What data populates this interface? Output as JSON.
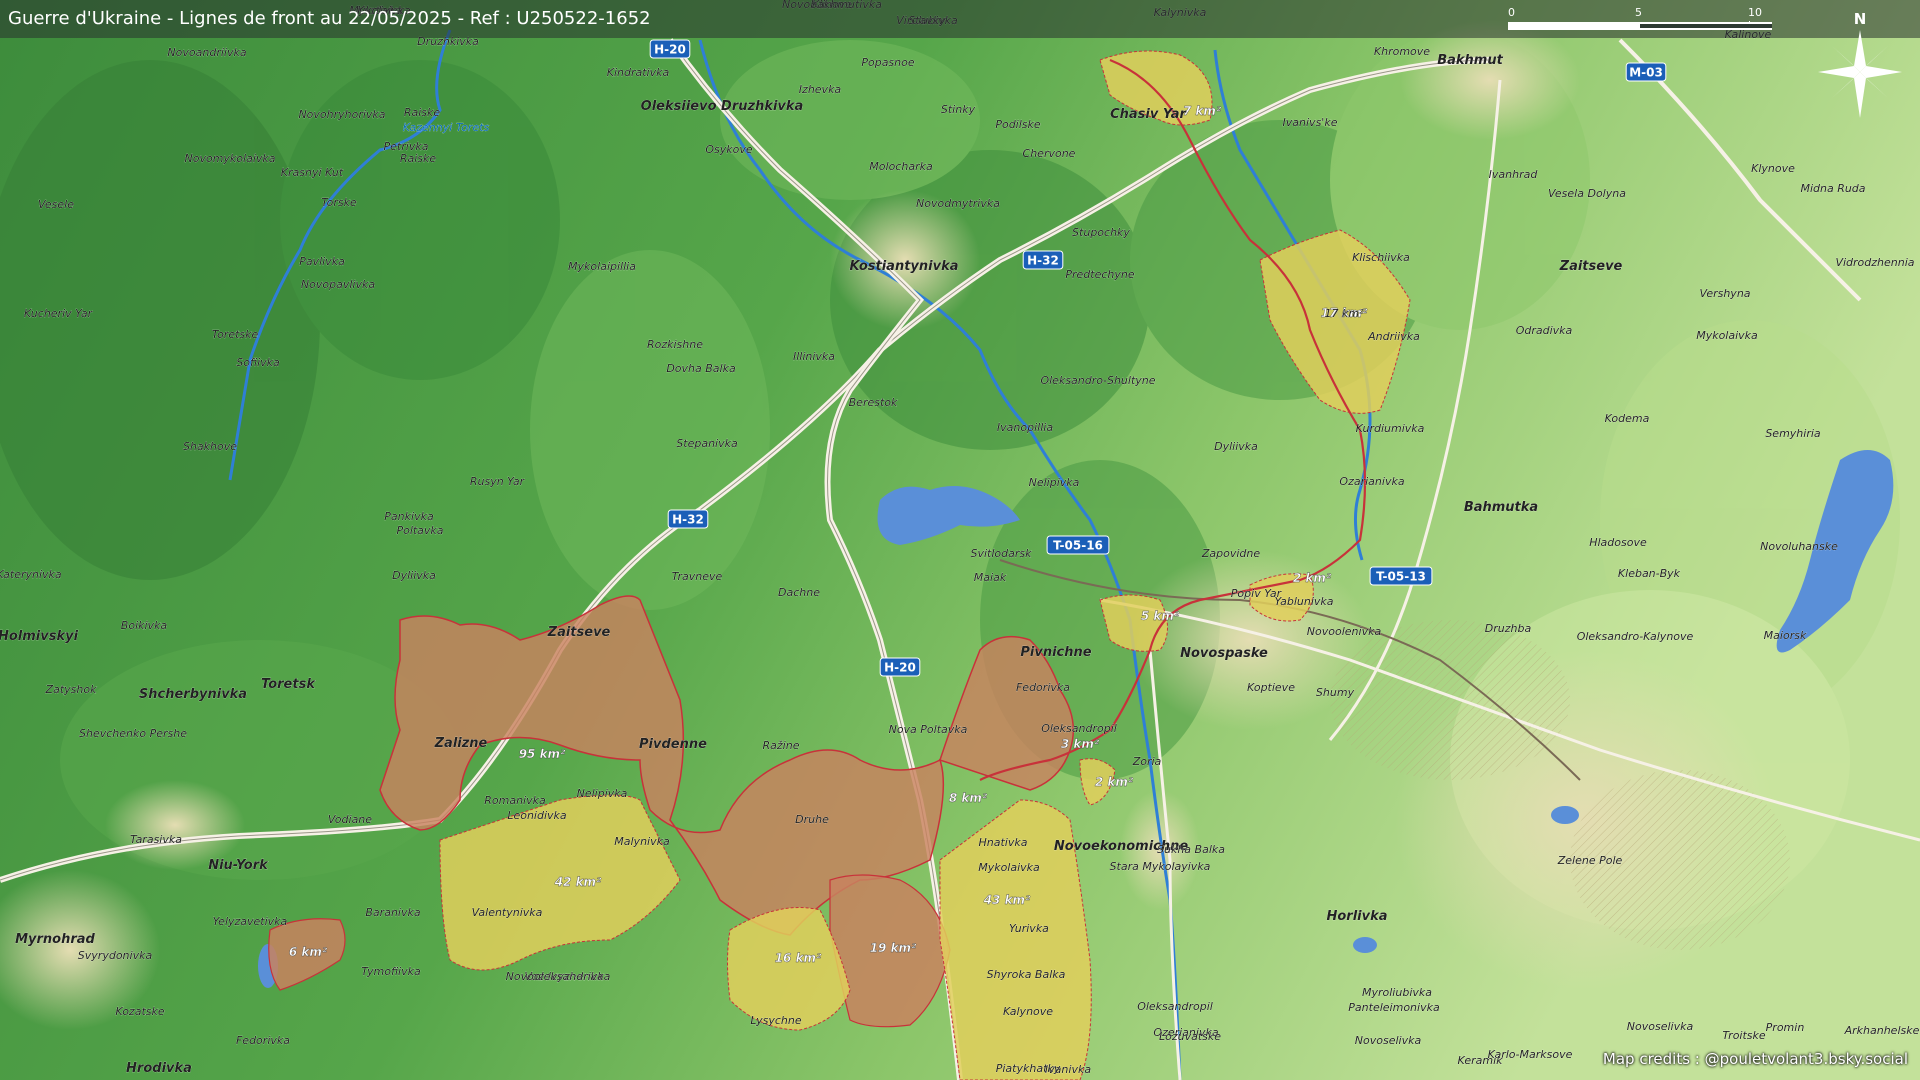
{
  "title": "Guerre d'Ukraine - Lignes de front au 22/05/2025 - Ref : U250522-1652",
  "credits": "Map credits : @pouletvolant3.bsky.social",
  "scale": {
    "ticks": [
      "0",
      "5",
      "10 km"
    ]
  },
  "north_label": "N",
  "colors": {
    "terrain_dark": "#3f8f3d",
    "terrain_light": "#cfe89a",
    "occupied": "#c8825f",
    "contested": "#e0cf5c",
    "frontline": "#c8323a",
    "river": "#2f7fd6",
    "road_badge": "#1b5fb8"
  },
  "road_labels": [
    "H-20",
    "H-32",
    "H-32",
    "H-20",
    "T-05-16",
    "T-05-13",
    "M-03"
  ],
  "areas": [
    "95 km²",
    "42 km²",
    "6 km²",
    "16 km²",
    "19 km²",
    "8 km²",
    "43 km²",
    "3 km²",
    "2 km²",
    "5 km²",
    "2 km²",
    "17 km²",
    "7 km²"
  ],
  "places": [
    "Kurtivka",
    "Klinove",
    "Virolubivka",
    "Kalynivka",
    "Druzhkivka",
    "Novoandriivka",
    "Kindrativka",
    "Popasnoe",
    "Oleksiievo Druzhkivka",
    "Izhevka",
    "Stinky",
    "Podilske",
    "Chasiv Yar",
    "Ivanivs'ke",
    "Khromove",
    "Bakhmut",
    "Kalinove",
    "Raiske",
    "Novohryhorivka",
    "Kazennyi Torets",
    "Petrivka",
    "Raiske",
    "Novomykolaivka",
    "Osykove",
    "Molocharka",
    "Chervone",
    "Ivanhrad",
    "Vesela Dolyna",
    "Klynove",
    "Midna Ruda",
    "Vesele",
    "Krasnyi Kut",
    "Torske",
    "Novodmytrivka",
    "Stupochky",
    "Kostiantynivka",
    "Predtechyne",
    "Klischiivka",
    "Zaitseve",
    "Vershyna",
    "Vidrodzhennia",
    "Pavlivka",
    "Novopavlivka",
    "Mykolaipillia",
    "Kucheriv Yar",
    "Toretske",
    "Sofiivka",
    "Rozkishne",
    "Dovha Balka",
    "Illinivka",
    "17 km²",
    "Andriivka",
    "Odradivka",
    "Mykolaivka",
    "Kodema",
    "Berestok",
    "Oleksandro-Shultyne",
    "Ivanopillia",
    "Kurdiumivka",
    "Semyhiria",
    "Shakhove",
    "Stepanivka",
    "Dyliivka",
    "Ozarianivka",
    "Rusyn Yar",
    "Nelipivka",
    "Bahmutka",
    "Pankivka",
    "Poltavka",
    "Hladosove",
    "Novoluhanske",
    "Svitlodarsk",
    "Maiak",
    "Kleban-Byk",
    "Katerynivka",
    "Dyliivka",
    "Travneve",
    "Zapovidne",
    "Popiv Yar",
    "Yablunivka",
    "Dachne",
    "Druzhba",
    "Oleksandro-Kalynove",
    "Zaitseve",
    "Holmivskyi",
    "Boikivka",
    "Novoolenivka",
    "Maiorsk",
    "Zatyshok",
    "Shcherbynivka",
    "Toretsk",
    "Pivnichne",
    "Novospaske",
    "Fedorivka",
    "Koptieve",
    "Shumy",
    "Shevchenko Pershe",
    "Zalizne",
    "Pivdenne",
    "Ražine",
    "Nova Poltavka",
    "Oleksandropil",
    "Zoria",
    "Romanivka",
    "Leonidivka",
    "Nelipivka",
    "Vodiane",
    "Druhe",
    "Tarasivka",
    "Malynivka",
    "Hnativka",
    "Novoekonomichne",
    "Zelene Pole",
    "Stara Mykolayivka",
    "Sukha Balka",
    "Niu-York",
    "Horlivka",
    "Mykolaivka",
    "Baranivka",
    "Valentynivka",
    "Yurivka",
    "Yelyzavetivka",
    "Vozdvyzhenka",
    "Shyroka Balka",
    "Myroliubivka",
    "Kalynove",
    "Panteleimonivka",
    "Myrnohrad",
    "Svyrydonivka",
    "Tymofiivka",
    "Novooleksandrivka",
    "Oleksandropil",
    "Ozerianivka",
    "Kozatske",
    "Lysychne",
    "Lozuvatske",
    "Novoselivka",
    "Promin",
    "Arkhanhelske",
    "Troitske",
    "Fedorivka",
    "Novoselivka",
    "Karlo-Marksove",
    "Hrodivka",
    "Ivanivka",
    "Keramik",
    "Piatykhatky",
    "Mykolaivka",
    "Novobakhmutivka",
    "Stavky"
  ]
}
